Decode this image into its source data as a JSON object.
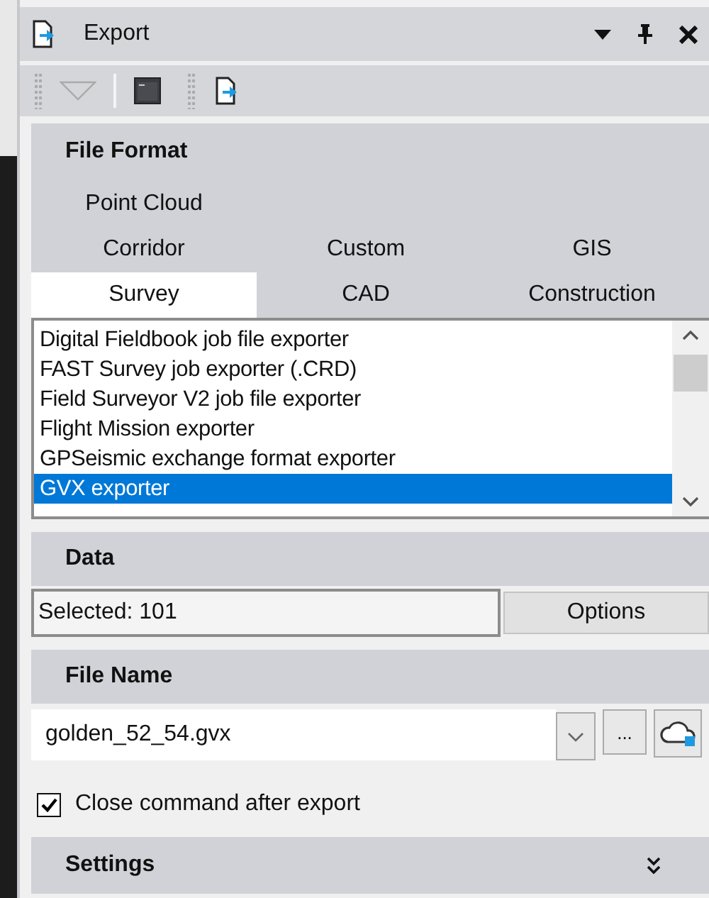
{
  "window": {
    "title": "Export"
  },
  "file_format": {
    "heading": "File Format",
    "tab_rows": [
      [
        {
          "label": "Point Cloud",
          "selected": false
        }
      ],
      [
        {
          "label": "Corridor",
          "selected": false
        },
        {
          "label": "Custom",
          "selected": false
        },
        {
          "label": "GIS",
          "selected": false
        }
      ],
      [
        {
          "label": "Survey",
          "selected": true
        },
        {
          "label": "CAD",
          "selected": false
        },
        {
          "label": "Construction",
          "selected": false
        }
      ]
    ],
    "exporters": [
      {
        "label": "Digital Fieldbook job file exporter",
        "selected": false
      },
      {
        "label": "FAST Survey job exporter (.CRD)",
        "selected": false
      },
      {
        "label": "Field Surveyor V2 job file exporter",
        "selected": false
      },
      {
        "label": "Flight Mission exporter",
        "selected": false
      },
      {
        "label": "GPSeismic exchange format exporter",
        "selected": false
      },
      {
        "label": "GVX exporter",
        "selected": true
      }
    ]
  },
  "data": {
    "heading": "Data",
    "selection": "Selected: 101",
    "options_button": "Options"
  },
  "file_name": {
    "heading": "File Name",
    "value": "golden_52_54.gvx",
    "browse_button": "..."
  },
  "close_after_export": {
    "label": "Close command after export",
    "checked": true
  },
  "settings": {
    "heading": "Settings",
    "expanded": false
  }
}
